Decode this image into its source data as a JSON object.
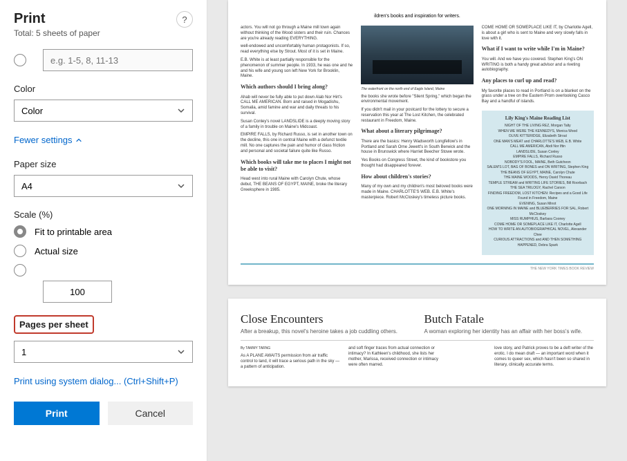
{
  "header": {
    "title": "Print",
    "subtitle": "Total: 5 sheets of paper"
  },
  "pages_field": {
    "placeholder": "e.g. 1-5, 8, 11-13"
  },
  "color": {
    "label": "Color",
    "value": "Color"
  },
  "settings_link": "Fewer settings",
  "paper_size": {
    "label": "Paper size",
    "value": "A4"
  },
  "scale": {
    "label": "Scale (%)",
    "options": {
      "fit": "Fit to printable area",
      "actual": "Actual size",
      "custom_value": "100"
    }
  },
  "pages_per_sheet": {
    "label": "Pages per sheet",
    "value": "1"
  },
  "system_dialog": "Print using system dialog... (Ctrl+Shift+P)",
  "buttons": {
    "print": "Print",
    "cancel": "Cancel"
  },
  "preview": {
    "page1": {
      "top_line": "ildren's books and inspiration for writers.",
      "col1_h1": "Which authors should I bring along?",
      "col1_h2": "Which books will take me to places I might not be able to visit?",
      "col2_caption": "The waterfront on the north end of Eagle Island, Maine",
      "col2_h1": "What about a literary pilgrimage?",
      "col2_h2": "How about children's stories?",
      "col3_h1": "What if I want to write while I'm in Maine?",
      "col3_h2": "Any places to curl up and read?",
      "reading_list_title": "Lily King's Maine Reading List",
      "footer": "THE NEW YORK TIMES BOOK REVIEW"
    },
    "page2": {
      "article1_title": "Close Encounters",
      "article1_sub": "After a breakup, this novel's heroine takes a job cuddling others.",
      "article1_byline": "By TAMMY TARNG",
      "article2_title": "Butch Fatale",
      "article2_sub": "A woman exploring her identity has an affair with her boss's wife."
    }
  }
}
